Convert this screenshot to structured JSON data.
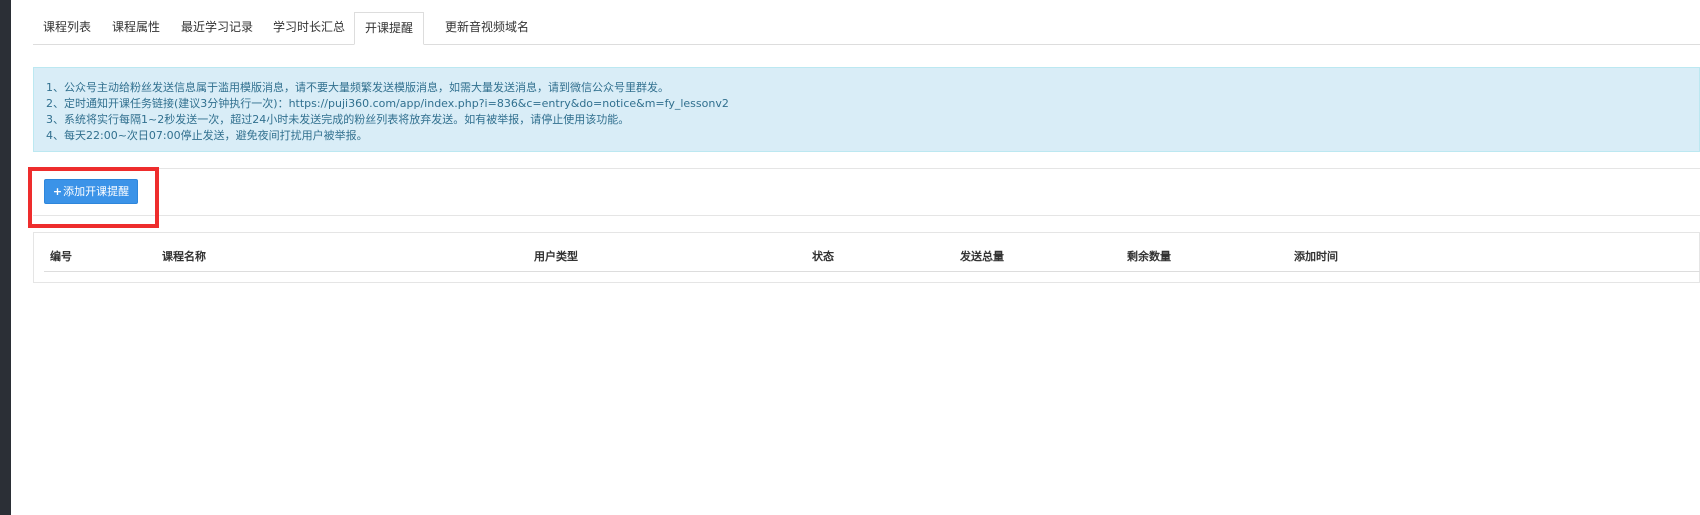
{
  "tabs": [
    {
      "label": "课程列表",
      "active": false
    },
    {
      "label": "课程属性",
      "active": false
    },
    {
      "label": "最近学习记录",
      "active": false
    },
    {
      "label": "学习时长汇总",
      "active": false
    },
    {
      "label": "开课提醒",
      "active": true
    },
    {
      "label": "更新音视频域名",
      "active": false
    }
  ],
  "notice": {
    "lines": [
      "1、公众号主动给粉丝发送信息属于滥用模版消息，请不要大量频繁发送模版消息，如需大量发送消息，请到微信公众号里群发。",
      "2、定时通知开课任务链接(建议3分钟执行一次)：https://puji360.com/app/index.php?i=836&c=entry&do=notice&m=fy_lessonv2",
      "3、系统将实行每隔1~2秒发送一次，超过24小时未发送完成的粉丝列表将放弃发送。如有被举报，请停止使用该功能。",
      "4、每天22:00~次日07:00停止发送，避免夜间打扰用户被举报。"
    ]
  },
  "toolbar": {
    "add_icon": "plus-icon",
    "add_label": "添加开课提醒"
  },
  "table": {
    "columns": [
      "编号",
      "课程名称",
      "用户类型",
      "状态",
      "发送总量",
      "剩余数量",
      "添加时间"
    ],
    "rows": []
  },
  "colors": {
    "alert_bg": "#d9edf7",
    "alert_text": "#31708f",
    "primary_button": "#3b93e8",
    "highlight_border": "#ee2d2d"
  }
}
